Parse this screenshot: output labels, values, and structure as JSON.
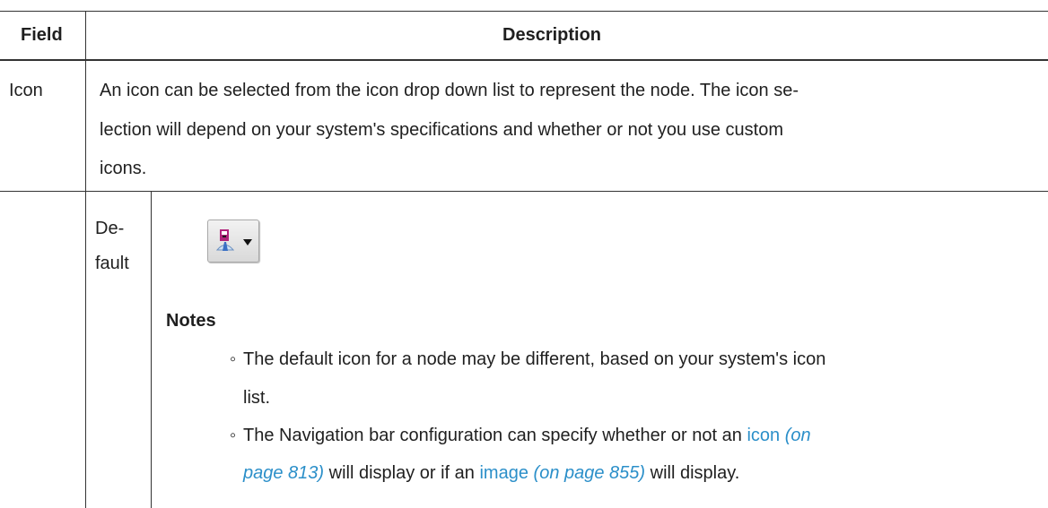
{
  "table": {
    "headers": {
      "field": "Field",
      "description": "Description"
    },
    "row_icon": {
      "field": "Icon",
      "lines": [
        "An icon can be selected from the icon drop down list to represent the node. The icon se-",
        "lection will depend on your system's specifications and whether or not you use custom",
        "icons."
      ]
    },
    "row_default": {
      "label_lines": [
        "De-",
        "fault"
      ],
      "dropdown_icon": "node-icon-dropdown",
      "notes_heading": "Notes",
      "note1": {
        "line1": "The default icon for a node may be different, based on your system's icon",
        "line2": "list."
      },
      "note2": {
        "text1": "The Navigation bar configuration can specify whether or not an ",
        "link1": "icon",
        "ref1": "(on",
        "ref1b": "page 813)",
        "text2": " will display or if an ",
        "link2": "image",
        "ref2": "(on page 855)",
        "text3": " will display."
      },
      "bullet": "◦"
    }
  },
  "colors": {
    "link": "#2b8fc9",
    "border": "#333333"
  }
}
